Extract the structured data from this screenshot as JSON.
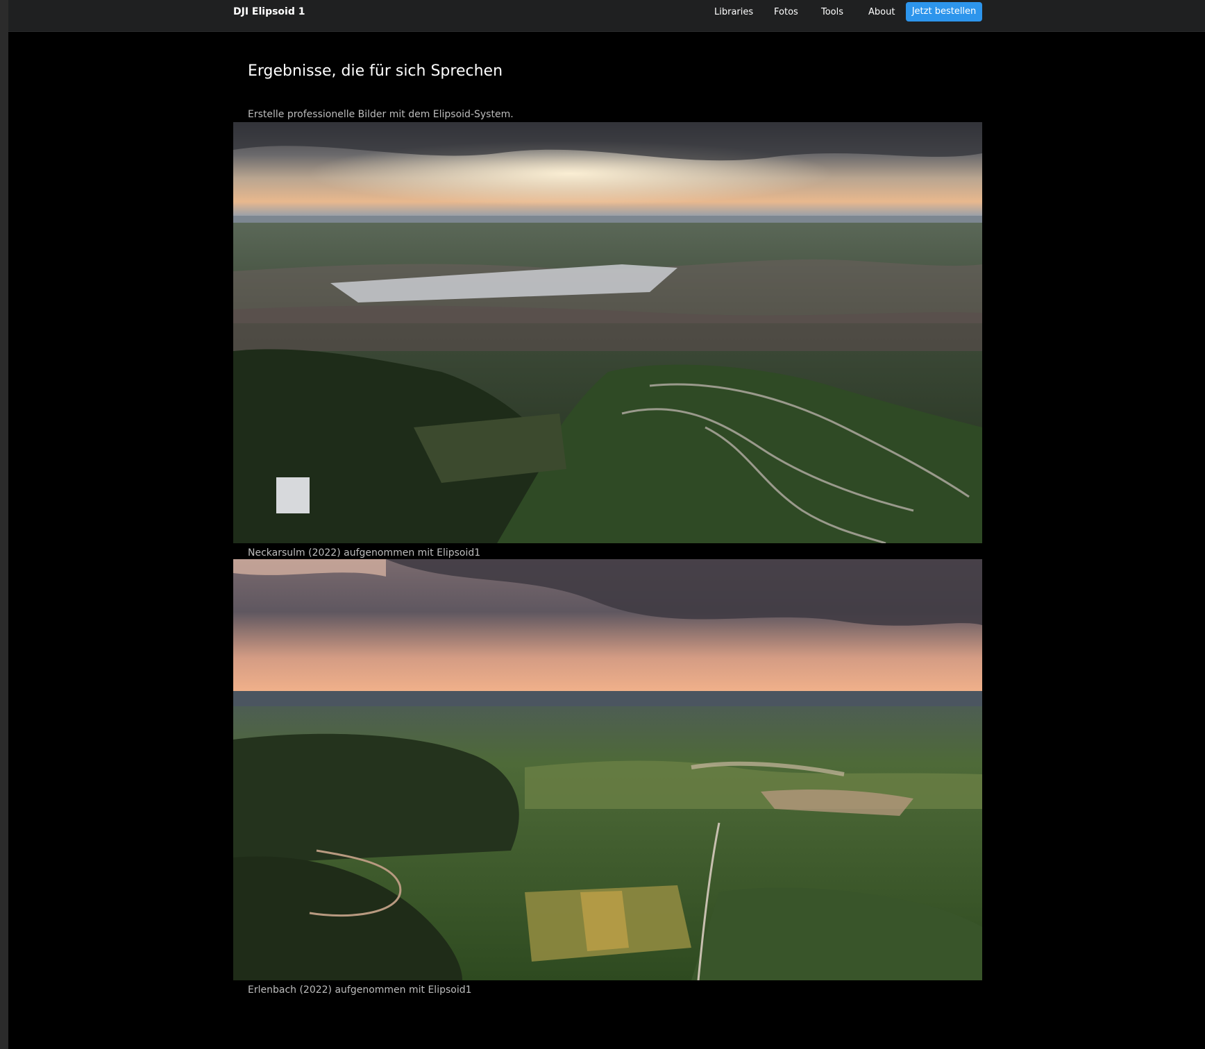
{
  "navbar": {
    "brand": "DJI Elipsoid 1",
    "items": [
      {
        "label": "Libraries"
      },
      {
        "label": "Fotos"
      },
      {
        "label": "Tools"
      },
      {
        "label": "About"
      }
    ],
    "cta_label": "Jetzt bestellen",
    "cta_color": "#2d95ec"
  },
  "main": {
    "title": "Ergebnisse, die für sich Sprechen",
    "subtitle": "Erstelle professionelle Bilder mit dem Elipsoid-System.",
    "photos": [
      {
        "caption": "Neckarsulm (2022) aufgenommen mit Elipsoid1"
      },
      {
        "caption": "Erlenbach (2022) aufgenommen mit Elipsoid1"
      }
    ]
  },
  "colors": {
    "background": "#000000",
    "navbar": "#1f2021",
    "text": "#ffffff",
    "muted_text": "#bdbdbd"
  }
}
